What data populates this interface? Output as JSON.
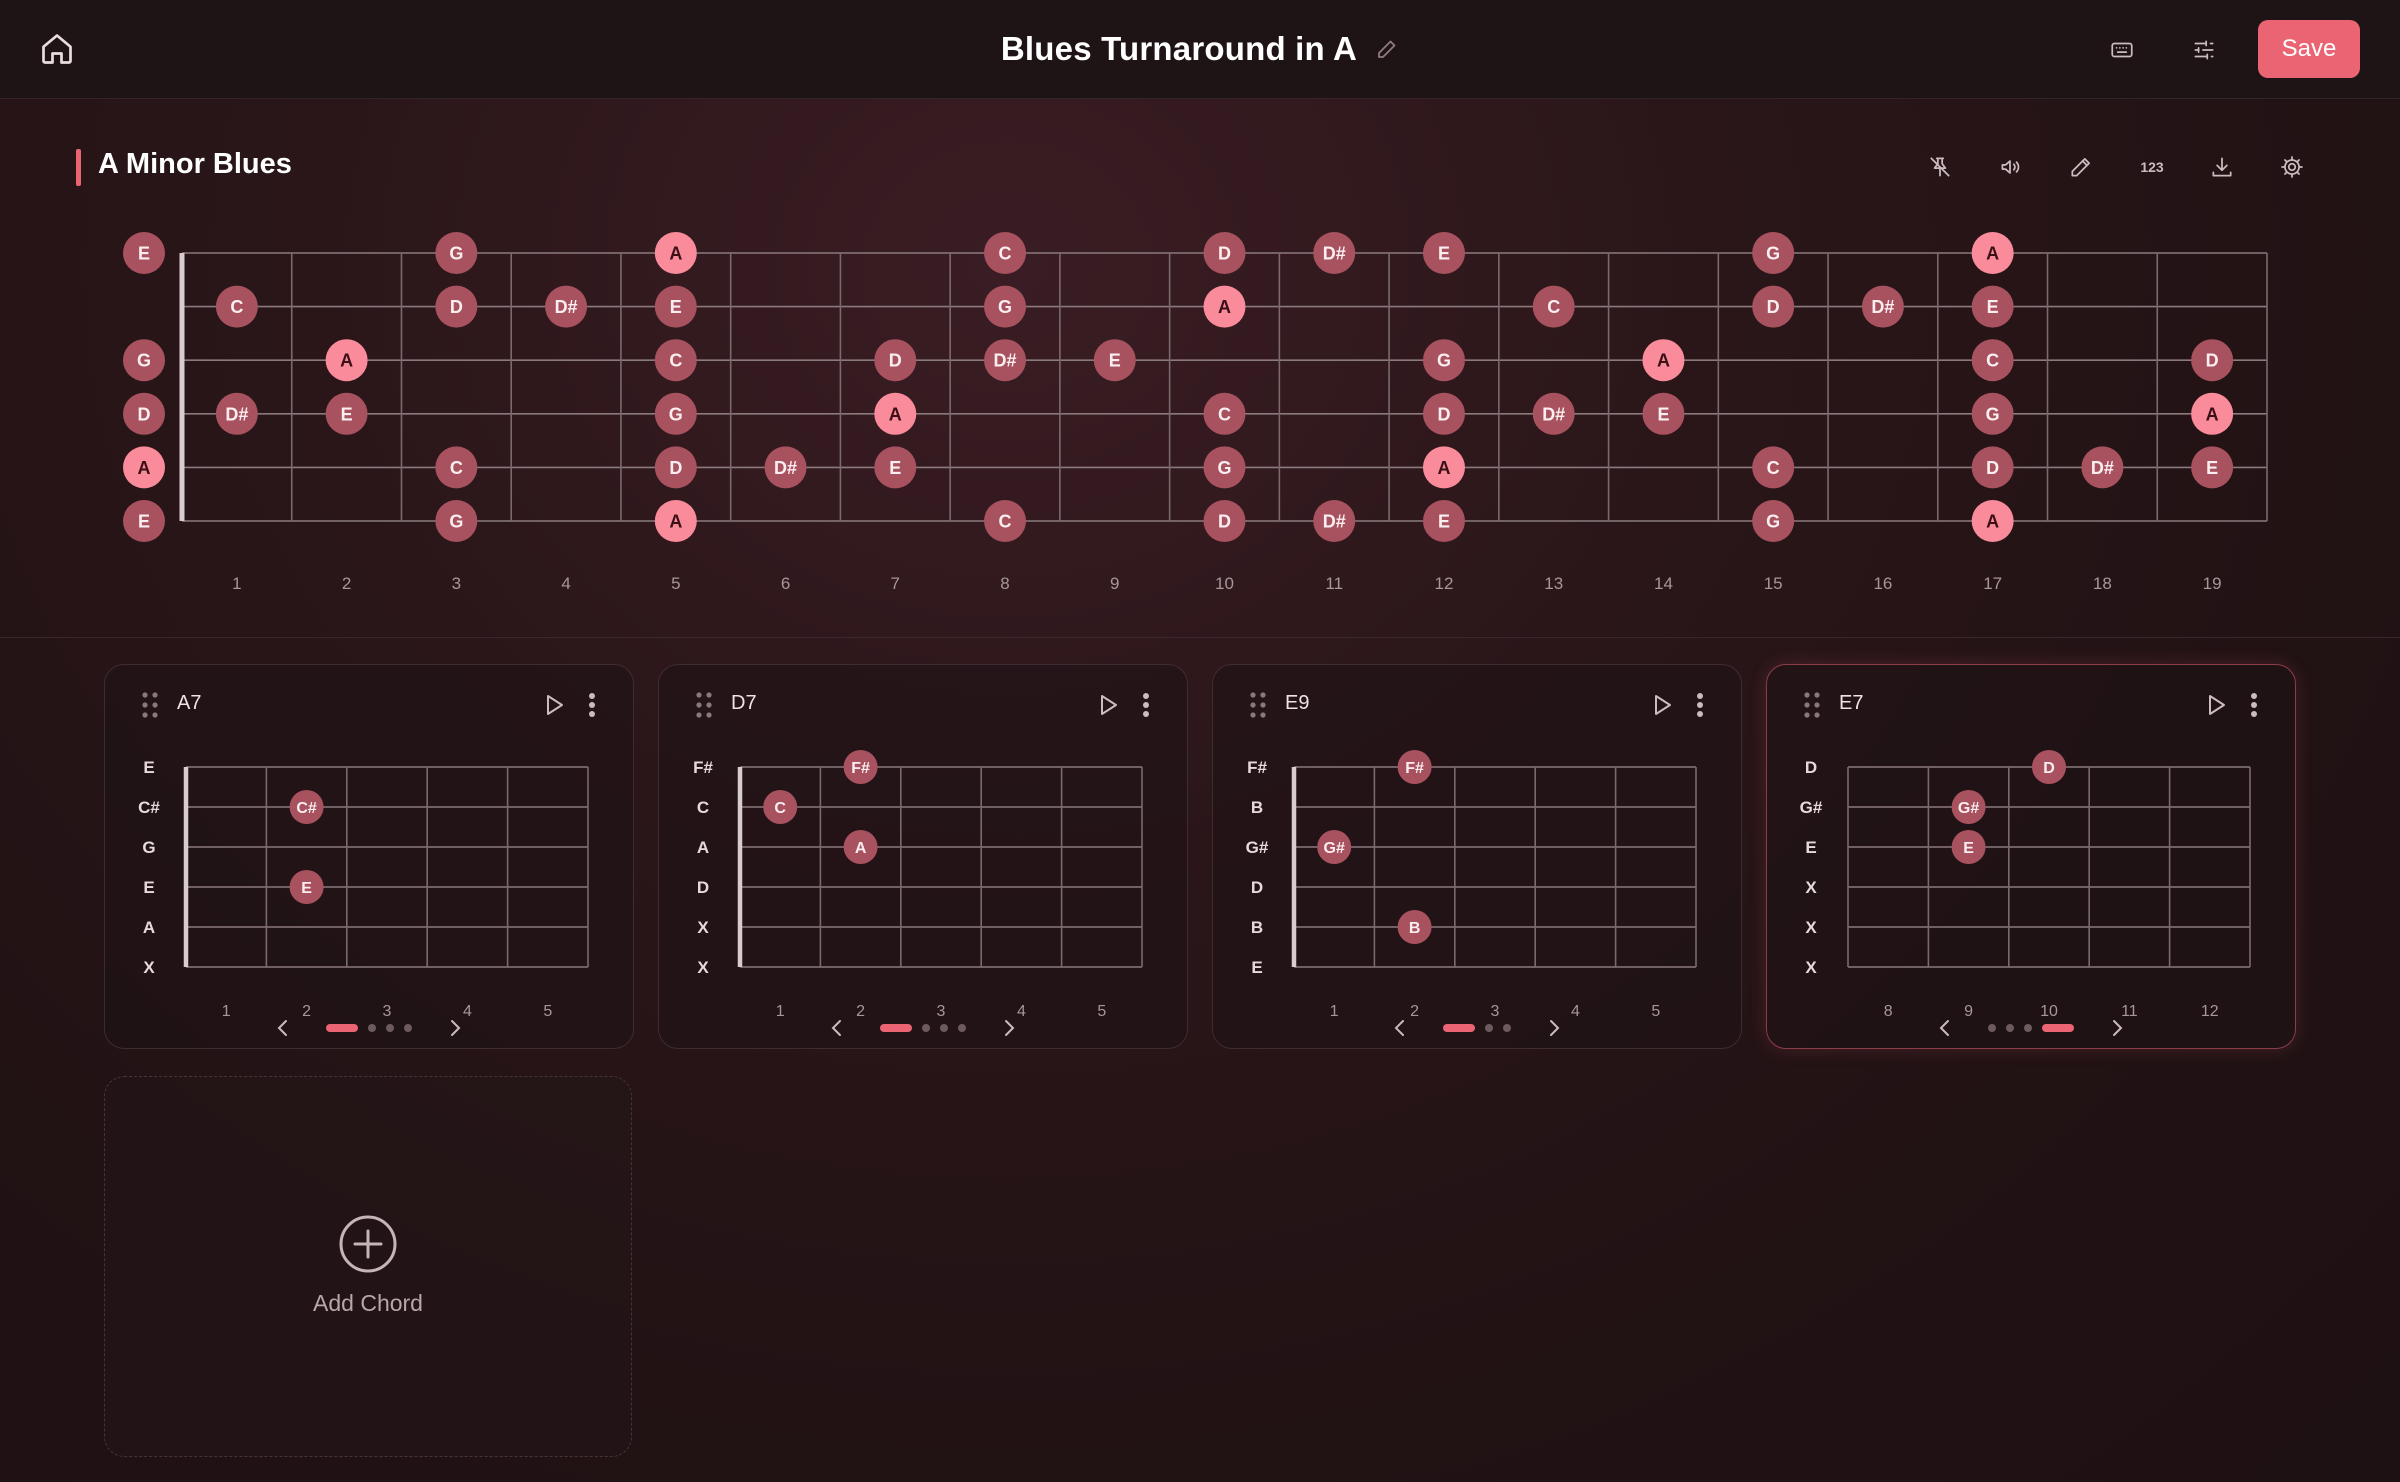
{
  "topbar": {
    "title": "Blues Turnaround in A",
    "save_label": "Save"
  },
  "scale": {
    "title": "A Minor Blues",
    "fret_numbers": [
      "1",
      "2",
      "3",
      "4",
      "5",
      "6",
      "7",
      "8",
      "9",
      "10",
      "11",
      "12",
      "13",
      "14",
      "15",
      "16",
      "17",
      "18",
      "19"
    ],
    "notes": [
      [
        "E",
        0,
        0
      ],
      [
        "G",
        0,
        3
      ],
      [
        "A",
        0,
        5
      ],
      [
        "C",
        0,
        8
      ],
      [
        "D",
        0,
        10
      ],
      [
        "D#",
        0,
        11
      ],
      [
        "E",
        0,
        12
      ],
      [
        "G",
        0,
        15
      ],
      [
        "A",
        0,
        17
      ],
      [
        "C",
        1,
        1
      ],
      [
        "D",
        1,
        3
      ],
      [
        "D#",
        1,
        4
      ],
      [
        "E",
        1,
        5
      ],
      [
        "G",
        1,
        8
      ],
      [
        "A",
        1,
        10
      ],
      [
        "C",
        1,
        13
      ],
      [
        "D",
        1,
        15
      ],
      [
        "D#",
        1,
        16
      ],
      [
        "E",
        1,
        17
      ],
      [
        "G",
        2,
        0
      ],
      [
        "A",
        2,
        2
      ],
      [
        "C",
        2,
        5
      ],
      [
        "D",
        2,
        7
      ],
      [
        "D#",
        2,
        8
      ],
      [
        "E",
        2,
        9
      ],
      [
        "G",
        2,
        12
      ],
      [
        "A",
        2,
        14
      ],
      [
        "C",
        2,
        17
      ],
      [
        "D",
        2,
        19
      ],
      [
        "D",
        3,
        0
      ],
      [
        "D#",
        3,
        1
      ],
      [
        "E",
        3,
        2
      ],
      [
        "G",
        3,
        5
      ],
      [
        "A",
        3,
        7
      ],
      [
        "C",
        3,
        10
      ],
      [
        "D",
        3,
        12
      ],
      [
        "D#",
        3,
        13
      ],
      [
        "E",
        3,
        14
      ],
      [
        "G",
        3,
        17
      ],
      [
        "A",
        3,
        19
      ],
      [
        "A",
        4,
        0
      ],
      [
        "C",
        4,
        3
      ],
      [
        "D",
        4,
        5
      ],
      [
        "D#",
        4,
        6
      ],
      [
        "E",
        4,
        7
      ],
      [
        "G",
        4,
        10
      ],
      [
        "A",
        4,
        12
      ],
      [
        "C",
        4,
        15
      ],
      [
        "D",
        4,
        17
      ],
      [
        "D#",
        4,
        18
      ],
      [
        "E",
        4,
        19
      ],
      [
        "E",
        5,
        0
      ],
      [
        "G",
        5,
        3
      ],
      [
        "A",
        5,
        5
      ],
      [
        "C",
        5,
        8
      ],
      [
        "D",
        5,
        10
      ],
      [
        "D#",
        5,
        11
      ],
      [
        "E",
        5,
        12
      ],
      [
        "G",
        5,
        15
      ],
      [
        "A",
        5,
        17
      ]
    ]
  },
  "chords": [
    {
      "name": "A7",
      "strings": [
        "E",
        "C#",
        "G",
        "E",
        "A",
        "X"
      ],
      "frets": [
        "1",
        "2",
        "3",
        "4",
        "5"
      ],
      "start": 1,
      "dots": [
        [
          "C#",
          1,
          2
        ],
        [
          "E",
          3,
          2
        ]
      ],
      "page": 0,
      "pages": 4,
      "active": false
    },
    {
      "name": "D7",
      "strings": [
        "F#",
        "C",
        "A",
        "D",
        "X",
        "X"
      ],
      "frets": [
        "1",
        "2",
        "3",
        "4",
        "5"
      ],
      "start": 1,
      "dots": [
        [
          "F#",
          0,
          2
        ],
        [
          "C",
          1,
          1
        ],
        [
          "A",
          2,
          2
        ]
      ],
      "page": 0,
      "pages": 4,
      "active": false
    },
    {
      "name": "E9",
      "strings": [
        "F#",
        "B",
        "G#",
        "D",
        "B",
        "E"
      ],
      "frets": [
        "1",
        "2",
        "3",
        "4",
        "5"
      ],
      "start": 1,
      "dots": [
        [
          "F#",
          0,
          2
        ],
        [
          "G#",
          2,
          1
        ],
        [
          "B",
          4,
          2
        ]
      ],
      "page": 0,
      "pages": 3,
      "active": false
    },
    {
      "name": "E7",
      "strings": [
        "D",
        "G#",
        "E",
        "X",
        "X",
        "X"
      ],
      "frets": [
        "8",
        "9",
        "10",
        "11",
        "12"
      ],
      "start": 8,
      "dots": [
        [
          "D",
          0,
          10
        ],
        [
          "G#",
          1,
          9
        ],
        [
          "E",
          2,
          9
        ]
      ],
      "page": 3,
      "pages": 4,
      "active": true
    }
  ],
  "add_chord": {
    "label": "Add Chord"
  },
  "colors": {
    "accent": "#ea6474",
    "root": "#f98b9a",
    "note": "#a8515f"
  },
  "icons": [
    "home-icon",
    "pencil-icon",
    "keyboard-icon",
    "sliders-icon",
    "pin-off-icon",
    "speaker-icon",
    "pencil-icon",
    "numbers-icon",
    "download-icon",
    "gear-icon",
    "drag-icon",
    "play-icon",
    "more-icon",
    "chevron-left-icon",
    "chevron-right-icon",
    "plus-circle-icon"
  ]
}
